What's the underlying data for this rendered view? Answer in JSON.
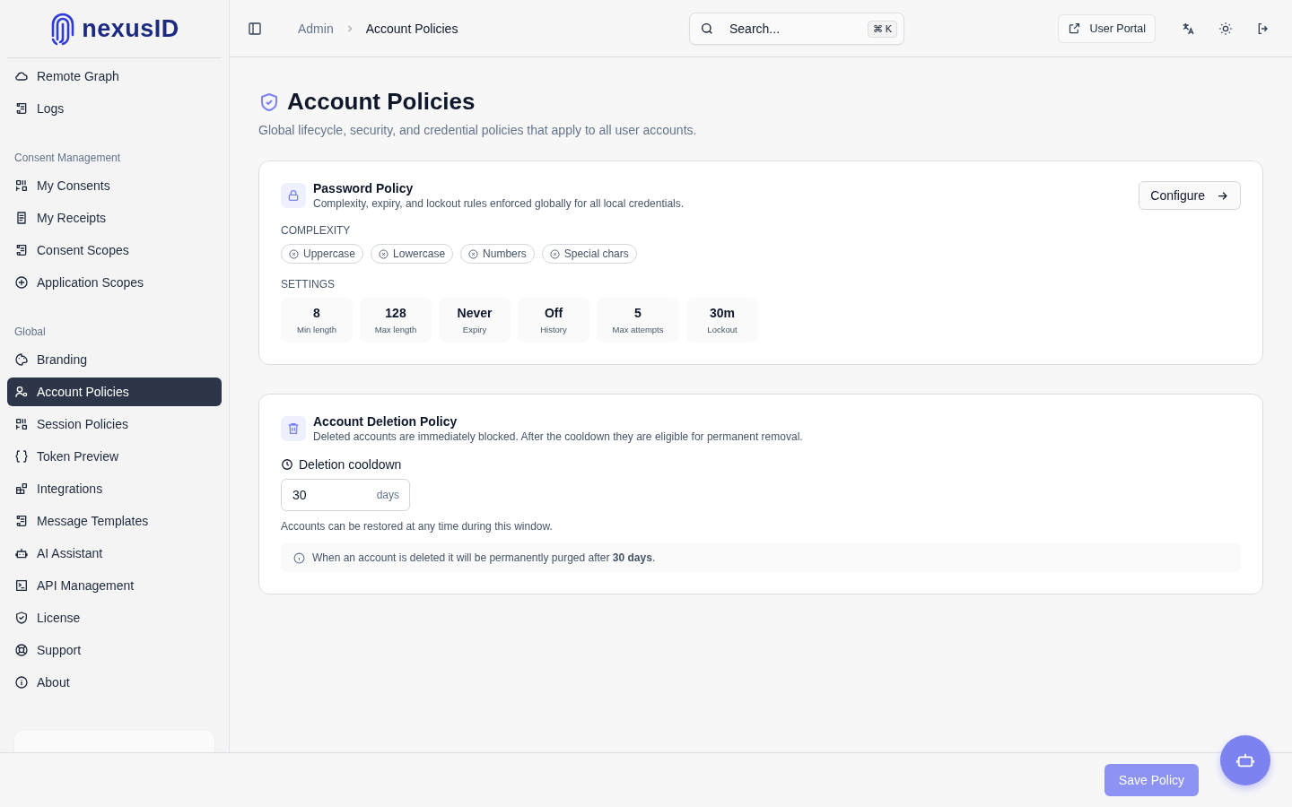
{
  "brand": {
    "name": "nexusID"
  },
  "sidebar": {
    "groups": [
      {
        "items": [
          {
            "label": "Remote Graph",
            "selected": false
          },
          {
            "label": "Logs",
            "selected": false
          }
        ]
      },
      {
        "heading": "Consent Management",
        "items": [
          {
            "label": "My Consents",
            "selected": false
          },
          {
            "label": "My Receipts",
            "selected": false
          },
          {
            "label": "Consent Scopes",
            "selected": false
          },
          {
            "label": "Application Scopes",
            "selected": false
          }
        ]
      },
      {
        "heading": "Global",
        "items": [
          {
            "label": "Branding",
            "selected": false
          },
          {
            "label": "Account Policies",
            "selected": true
          },
          {
            "label": "Session Policies",
            "selected": false
          },
          {
            "label": "Token Preview",
            "selected": false
          },
          {
            "label": "Integrations",
            "selected": false
          },
          {
            "label": "Message Templates",
            "selected": false
          },
          {
            "label": "AI Assistant",
            "selected": false
          },
          {
            "label": "API Management",
            "selected": false
          },
          {
            "label": "License",
            "selected": false
          },
          {
            "label": "Support",
            "selected": false
          },
          {
            "label": "About",
            "selected": false
          }
        ]
      }
    ]
  },
  "topbar": {
    "breadcrumb": [
      "Admin",
      "Account Policies"
    ],
    "search": {
      "placeholder": "Search...",
      "shortcut": "⌘ K"
    },
    "user_portal": "User Portal"
  },
  "page": {
    "title": "Account Policies",
    "subtitle": "Global lifecycle, security, and credential policies that apply to all user accounts."
  },
  "password_policy": {
    "title": "Password Policy",
    "description": "Complexity, expiry, and lockout rules enforced globally for all local credentials.",
    "configure": "Configure",
    "complexity_label": "COMPLEXITY",
    "complexity": [
      {
        "label": "Uppercase",
        "enabled": false
      },
      {
        "label": "Lowercase",
        "enabled": false
      },
      {
        "label": "Numbers",
        "enabled": false
      },
      {
        "label": "Special chars",
        "enabled": false
      }
    ],
    "settings_label": "SETTINGS",
    "settings": [
      {
        "value": "8",
        "label": "Min length"
      },
      {
        "value": "128",
        "label": "Max length"
      },
      {
        "value": "Never",
        "label": "Expiry"
      },
      {
        "value": "Off",
        "label": "History"
      },
      {
        "value": "5",
        "label": "Max attempts"
      },
      {
        "value": "30m",
        "label": "Lockout"
      }
    ]
  },
  "deletion_policy": {
    "title": "Account Deletion Policy",
    "description": "Deleted accounts are immediately blocked. After the cooldown they are eligible for permanent removal.",
    "field_label": "Deletion cooldown",
    "value": "30",
    "unit": "days",
    "hint": "Accounts can be restored at any time during this window.",
    "notice": "When an account is deleted it will be permanently purged after **30 days**."
  },
  "footer": {
    "save": "Save Policy",
    "save_disabled": true
  }
}
